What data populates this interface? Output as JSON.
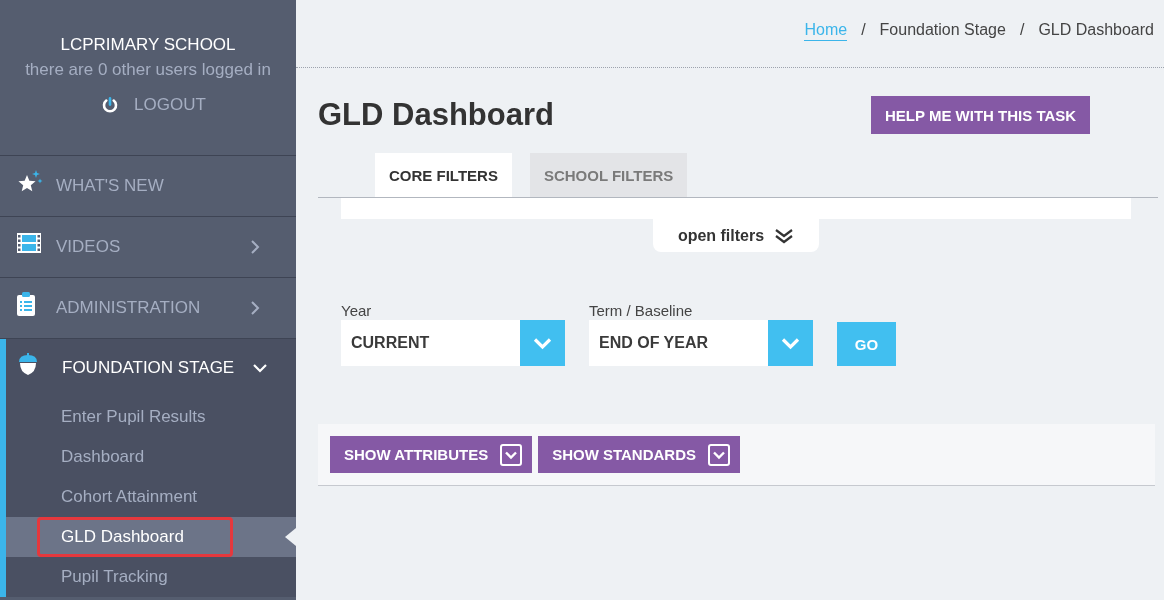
{
  "sidebar": {
    "school_name": "LCPRIMARY SCHOOL",
    "users_note": "there are 0 other users logged in",
    "logout": "LOGOUT",
    "nav": [
      {
        "label": "WHAT'S NEW",
        "kind": "link",
        "expanded": false
      },
      {
        "label": "VIDEOS",
        "kind": "menu",
        "expanded": false
      },
      {
        "label": "ADMINISTRATION",
        "kind": "menu",
        "expanded": false
      },
      {
        "label": "FOUNDATION STAGE",
        "kind": "menu",
        "expanded": true,
        "children": [
          {
            "label": "Enter Pupil Results",
            "selected": false,
            "highlighted": false
          },
          {
            "label": "Dashboard",
            "selected": false,
            "highlighted": false
          },
          {
            "label": "Cohort Attainment",
            "selected": false,
            "highlighted": false
          },
          {
            "label": "GLD Dashboard",
            "selected": true,
            "highlighted": true
          },
          {
            "label": "Pupil Tracking",
            "selected": false,
            "highlighted": false
          }
        ]
      }
    ]
  },
  "breadcrumb": [
    {
      "kind": "link",
      "label": "Home"
    },
    {
      "kind": "separator",
      "label": "/"
    },
    {
      "kind": "text",
      "label": "Foundation Stage"
    },
    {
      "kind": "separator",
      "label": "/"
    },
    {
      "kind": "text",
      "label": "GLD Dashboard"
    }
  ],
  "page_title": "GLD Dashboard",
  "help_button": "HELP ME WITH THIS TASK",
  "tabs": [
    {
      "label": "CORE FILTERS",
      "selected": true
    },
    {
      "label": "SCHOOL FILTERS",
      "selected": false
    }
  ],
  "open_filters": {
    "label": "open filters",
    "expanded": false
  },
  "filters": [
    {
      "label": "Year",
      "value": "CURRENT"
    },
    {
      "label": "Term / Baseline",
      "value": "END OF YEAR"
    }
  ],
  "go_button": "GO",
  "toggles": [
    {
      "label": "SHOW ATTRIBUTES"
    },
    {
      "label": "SHOW STANDARDS"
    }
  ]
}
